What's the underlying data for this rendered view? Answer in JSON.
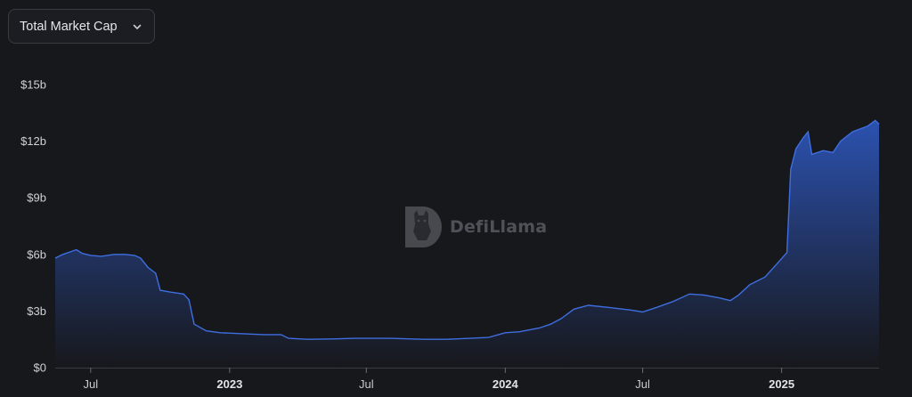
{
  "selector": {
    "label": "Total Market Cap",
    "icon": "chevron-down-icon"
  },
  "watermark": {
    "text": "DefiLlama",
    "icon": "llama-logo-icon"
  },
  "colors": {
    "background": "#17181c",
    "line": "#3e6ee0",
    "fill_top": "#2d55b8",
    "fill_bottom": "#17181c",
    "axis": "#3a3c43"
  },
  "chart_data": {
    "type": "area",
    "title": "",
    "xlabel": "",
    "ylabel": "",
    "xlim": [
      "2022-05-15",
      "2025-05-10"
    ],
    "ylim": [
      0,
      15
    ],
    "y_unit": "billions USD",
    "y_ticks": [
      {
        "value": 0,
        "label": "$0"
      },
      {
        "value": 3,
        "label": "$3b"
      },
      {
        "value": 6,
        "label": "$6b"
      },
      {
        "value": 9,
        "label": "$9b"
      },
      {
        "value": 12,
        "label": "$12b"
      },
      {
        "value": 15,
        "label": "$15b"
      }
    ],
    "x_ticks": [
      {
        "date": "2022-07-01",
        "label": "Jul",
        "major": false
      },
      {
        "date": "2023-01-01",
        "label": "2023",
        "major": true
      },
      {
        "date": "2023-07-01",
        "label": "Jul",
        "major": false
      },
      {
        "date": "2024-01-01",
        "label": "2024",
        "major": true
      },
      {
        "date": "2024-07-01",
        "label": "Jul",
        "major": false
      },
      {
        "date": "2025-01-01",
        "label": "2025",
        "major": true
      }
    ],
    "grid": false,
    "legend": "none",
    "series": [
      {
        "points": [
          [
            "2022-05-15",
            5.8
          ],
          [
            "2022-05-25",
            6.0
          ],
          [
            "2022-06-05",
            6.15
          ],
          [
            "2022-06-12",
            6.25
          ],
          [
            "2022-06-20",
            6.05
          ],
          [
            "2022-07-01",
            5.95
          ],
          [
            "2022-07-15",
            5.9
          ],
          [
            "2022-08-01",
            6.0
          ],
          [
            "2022-08-15",
            6.0
          ],
          [
            "2022-08-28",
            5.95
          ],
          [
            "2022-09-05",
            5.8
          ],
          [
            "2022-09-15",
            5.3
          ],
          [
            "2022-09-25",
            5.0
          ],
          [
            "2022-10-01",
            4.1
          ],
          [
            "2022-10-15",
            4.0
          ],
          [
            "2022-11-01",
            3.9
          ],
          [
            "2022-11-08",
            3.6
          ],
          [
            "2022-11-15",
            2.3
          ],
          [
            "2022-12-01",
            1.95
          ],
          [
            "2022-12-20",
            1.85
          ],
          [
            "2023-01-15",
            1.8
          ],
          [
            "2023-02-15",
            1.75
          ],
          [
            "2023-03-10",
            1.75
          ],
          [
            "2023-03-20",
            1.55
          ],
          [
            "2023-04-15",
            1.5
          ],
          [
            "2023-05-15",
            1.52
          ],
          [
            "2023-06-15",
            1.55
          ],
          [
            "2023-08-01",
            1.55
          ],
          [
            "2023-09-15",
            1.5
          ],
          [
            "2023-10-15",
            1.5
          ],
          [
            "2023-11-15",
            1.55
          ],
          [
            "2023-12-10",
            1.6
          ],
          [
            "2024-01-01",
            1.85
          ],
          [
            "2024-01-20",
            1.9
          ],
          [
            "2024-02-15",
            2.1
          ],
          [
            "2024-03-01",
            2.3
          ],
          [
            "2024-03-15",
            2.6
          ],
          [
            "2024-04-01",
            3.1
          ],
          [
            "2024-04-20",
            3.3
          ],
          [
            "2024-05-15",
            3.2
          ],
          [
            "2024-06-15",
            3.05
          ],
          [
            "2024-07-01",
            2.95
          ],
          [
            "2024-07-20",
            3.2
          ],
          [
            "2024-08-10",
            3.5
          ],
          [
            "2024-09-01",
            3.9
          ],
          [
            "2024-09-20",
            3.85
          ],
          [
            "2024-10-10",
            3.7
          ],
          [
            "2024-10-25",
            3.55
          ],
          [
            "2024-11-05",
            3.85
          ],
          [
            "2024-11-20",
            4.4
          ],
          [
            "2024-12-10",
            4.8
          ],
          [
            "2024-12-28",
            5.6
          ],
          [
            "2025-01-08",
            6.1
          ],
          [
            "2025-01-13",
            10.5
          ],
          [
            "2025-01-20",
            11.6
          ],
          [
            "2025-01-30",
            12.2
          ],
          [
            "2025-02-05",
            12.5
          ],
          [
            "2025-02-10",
            11.3
          ],
          [
            "2025-02-25",
            11.5
          ],
          [
            "2025-03-10",
            11.4
          ],
          [
            "2025-03-20",
            12.0
          ],
          [
            "2025-04-05",
            12.5
          ],
          [
            "2025-04-25",
            12.8
          ],
          [
            "2025-05-05",
            13.1
          ],
          [
            "2025-05-10",
            12.9
          ]
        ]
      }
    ]
  }
}
